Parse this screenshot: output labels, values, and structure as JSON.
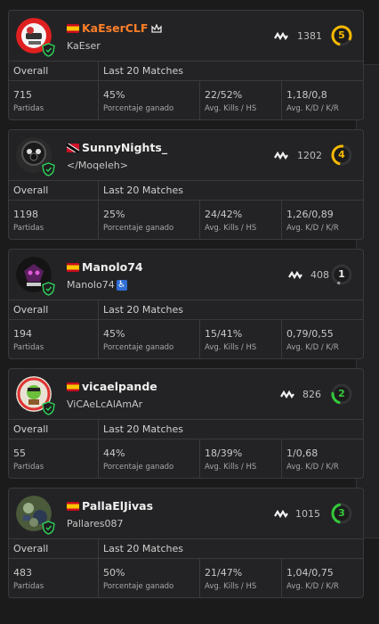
{
  "labels": {
    "overall": "Overall",
    "last20": "Last 20 Matches",
    "partidas": "Partidas",
    "porcentaje": "Porcentaje ganado",
    "kills_hs": "Avg. Kills / HS",
    "kd_kr": "Avg. K/D / K/R"
  },
  "colors": {
    "level_yellow": "#f5b800",
    "level_gray": "#9a9a9a",
    "level_green": "#34c93a",
    "name_orange": "#ff7f28"
  },
  "players": [
    {
      "name": "KaEserCLF",
      "crown_icon": "crown-icon",
      "flag": "es",
      "subname": "KaEser",
      "elo": "1381",
      "level": "5",
      "level_color": "#f5b800",
      "level_fill": 0.8,
      "matches": "715",
      "winrate": "45%",
      "kills_hs": "22/52%",
      "kd_kr": "1,18/0,8"
    },
    {
      "name": "SunnyNights_",
      "flag": "tt",
      "subname": "</Moqeleh>",
      "elo": "1202",
      "level": "4",
      "level_color": "#f5b800",
      "level_fill": 0.5,
      "matches": "1198",
      "winrate": "25%",
      "kills_hs": "24/42%",
      "kd_kr": "1,26/0,89"
    },
    {
      "name": "Manolo74",
      "flag": "es",
      "subname": "Manolo74",
      "wheelchair_icon": "wheelchair-icon",
      "elo": "408",
      "level": "1",
      "level_color": "#9a9a9a",
      "level_fill": 0.05,
      "matches": "194",
      "winrate": "45%",
      "kills_hs": "15/41%",
      "kd_kr": "0,79/0,55"
    },
    {
      "name": "vicaelpande",
      "flag": "es",
      "subname": "ViCAeLcAlAmAr",
      "elo": "826",
      "level": "2",
      "level_color": "#34c93a",
      "level_fill": 0.25,
      "matches": "55",
      "winrate": "44%",
      "kills_hs": "18/39%",
      "kd_kr": "1/0,68"
    },
    {
      "name": "PallaElJivas",
      "flag": "es",
      "subname": "Pallares087",
      "elo": "1015",
      "level": "3",
      "level_color": "#34c93a",
      "level_fill": 0.45,
      "matches": "483",
      "winrate": "50%",
      "kills_hs": "21/47%",
      "kd_kr": "1,04/0,75"
    }
  ]
}
